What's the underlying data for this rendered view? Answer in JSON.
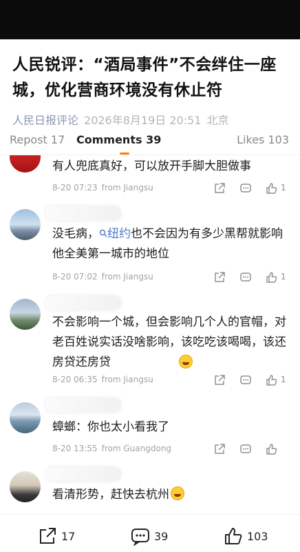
{
  "article": {
    "title": "人民锐评：“酒局事件”不会绊住一座城，优化营商环境没有休止符",
    "source": "人民日报评论",
    "datetime": "2026年8月19日 20:51",
    "location": "北京"
  },
  "tabs": {
    "repost": "Repost 17",
    "comments": "Comments 39",
    "likes": "Likes 103"
  },
  "comments": [
    {
      "text": "有人兜底真好，可以放开手脚大胆做事",
      "time": "8-20 07:23",
      "from": "from Jiangsu",
      "likes": "1"
    },
    {
      "text_before": "没毛病，",
      "link": "纽约",
      "text_after": "也不会因为有多少黑帮就影响他全美第一城市的地位",
      "time": "8-20 07:02",
      "from": "from Jiangsu",
      "likes": "1"
    },
    {
      "text": "不会影响一个城，但会影响几个人的官帽，对老百姓说实话没啥影响，该吃吃该喝喝，该还房贷还房贷",
      "time": "8-20 06:35",
      "from": "from Jiangsu",
      "likes": "1"
    },
    {
      "text": "蟑螂：你也太小看我了",
      "time": "8-20 13:55",
      "from": "from Guangdong",
      "likes": ""
    },
    {
      "text": "看清形势，赶快去杭州",
      "time": "",
      "from": "",
      "likes": ""
    }
  ],
  "bottom": {
    "repost_count": "17",
    "comment_count": "39",
    "like_count": "103"
  },
  "icons": {
    "share": "share-icon",
    "reply": "reply-icon",
    "like": "thumbs-up-icon",
    "search": "search-icon"
  },
  "colors": {
    "accent": "#ff8200",
    "link": "#4d7cc7",
    "source": "#8a97b0"
  }
}
